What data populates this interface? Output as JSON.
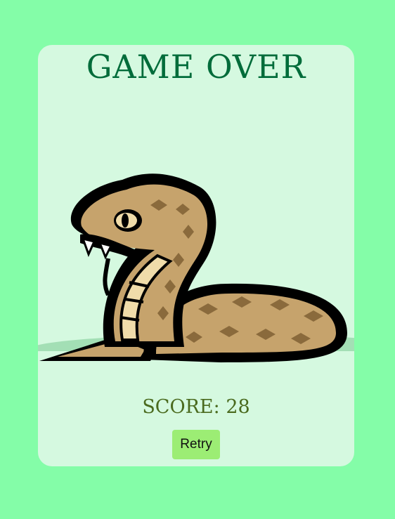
{
  "title": "GAME OVER",
  "score_text": "SCORE: 28",
  "retry_label": "Retry",
  "colors": {
    "background": "#84fda8",
    "card": "#d5f9e0",
    "title": "#006c3a",
    "score": "#4a6a1e",
    "button": "#9ced74"
  },
  "illustration": "snake-mascot"
}
